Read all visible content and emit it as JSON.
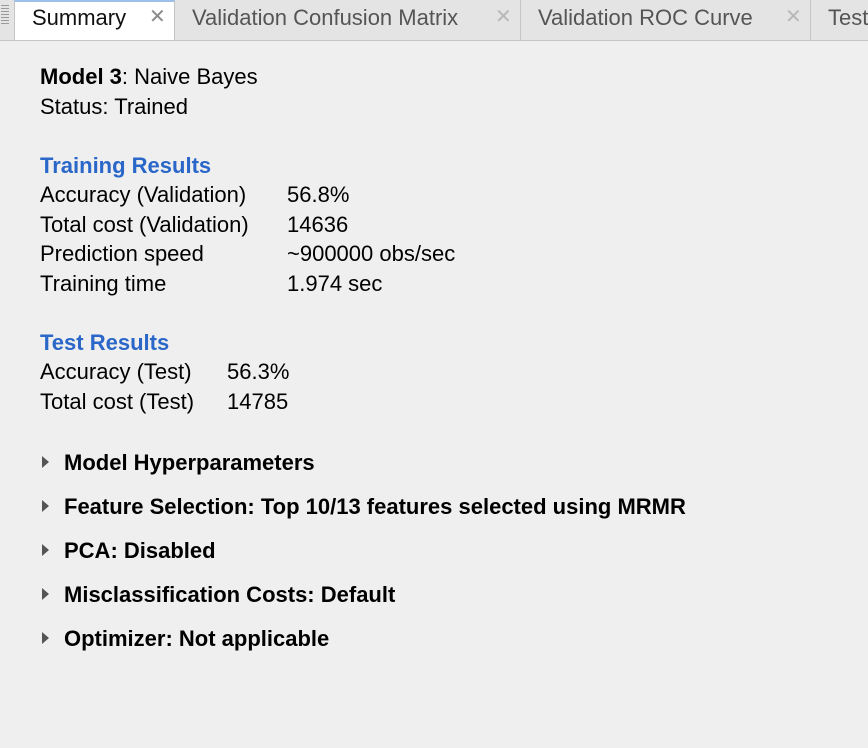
{
  "tabs": [
    {
      "label": "Summary",
      "active": true
    },
    {
      "label": "Validation Confusion Matrix",
      "active": false
    },
    {
      "label": "Validation ROC Curve",
      "active": false
    },
    {
      "label": "Test",
      "active": false
    }
  ],
  "tab_close_glyph": "✕",
  "model": {
    "name_label": "Model 3",
    "name_value": ": Naive Bayes",
    "status": "Status: Trained"
  },
  "training_results": {
    "title": "Training Results",
    "rows": [
      {
        "label": "Accuracy (Validation)",
        "value": "56.8%"
      },
      {
        "label": "Total cost (Validation)",
        "value": "14636"
      },
      {
        "label": "Prediction speed",
        "value": "~900000 obs/sec"
      },
      {
        "label": "Training time",
        "value": "1.974 sec"
      }
    ]
  },
  "test_results": {
    "title": "Test Results",
    "rows": [
      {
        "label": "Accuracy (Test)",
        "value": "56.3%"
      },
      {
        "label": "Total cost (Test)",
        "value": "14785"
      }
    ]
  },
  "sections": [
    {
      "label": "Model Hyperparameters",
      "icon": "disclosure-triangle-icon"
    },
    {
      "label": "Feature Selection: Top 10/13 features selected using MRMR",
      "icon": "disclosure-triangle-icon"
    },
    {
      "label": "PCA: Disabled",
      "icon": "disclosure-triangle-icon"
    },
    {
      "label": "Misclassification Costs: Default",
      "icon": "disclosure-triangle-icon"
    },
    {
      "label": "Optimizer: Not applicable",
      "icon": "disclosure-triangle-icon"
    }
  ],
  "colors": {
    "section_title": "#2a67c9",
    "active_tab_accent": "#9cc0ea",
    "background": "#efefef"
  }
}
